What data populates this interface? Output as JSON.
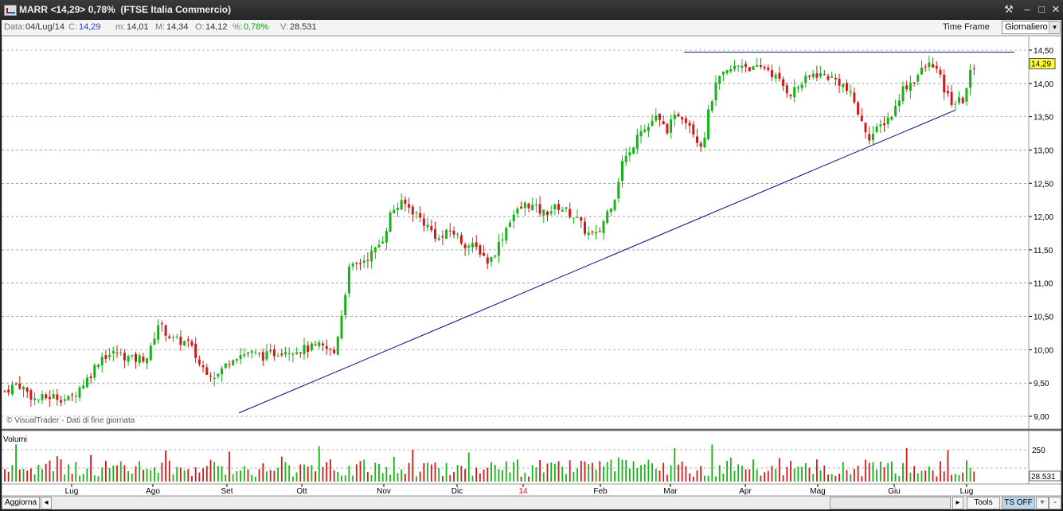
{
  "window": {
    "title": "MARR <14,29> 0,78%  (FTSE Italia Commercio)",
    "buttons": [
      "⚒",
      "–",
      "□",
      "✕"
    ]
  },
  "info": {
    "data_label": "Data:",
    "data_value": "04/Lug/14",
    "close_label": "C:",
    "close_value": "14,29",
    "min_label": "m:",
    "min_value": "14,01",
    "max_label": "M:",
    "max_value": "14,34",
    "open_label": "O:",
    "open_value": "14,12",
    "pct_label": "%:",
    "pct_value": "0,78%",
    "vol_label": "V:",
    "vol_value": "28.531",
    "timeframe_label": "Time Frame",
    "timeframe_value": "Giornaliero"
  },
  "chart_data": {
    "type": "candlestick",
    "security": "MARR",
    "watermark": "© VisualTrader - Dati di fine giornata",
    "y_ticks": [
      "14,50",
      "14,00",
      "13,50",
      "13,00",
      "12,50",
      "12,00",
      "11,50",
      "11,00",
      "10,50",
      "10,00",
      "9,50",
      "9,00"
    ],
    "ylim": [
      9.0,
      14.5
    ],
    "last_price_label": "14,29",
    "volume_label": "Volumi",
    "volume_tick": "250",
    "last_volume_label": "28.531",
    "x_labels": [
      "Lug",
      "Ago",
      "Set",
      "Ott",
      "Nov",
      "Dic",
      "14",
      "Feb",
      "Mar",
      "Apr",
      "Mag",
      "Giu",
      "Lug"
    ],
    "series": {
      "approximate_close_path": [
        [
          0,
          9.35
        ],
        [
          20,
          9.5
        ],
        [
          42,
          9.25
        ],
        [
          65,
          9.3
        ],
        [
          85,
          9.25
        ],
        [
          110,
          9.6
        ],
        [
          125,
          9.9
        ],
        [
          145,
          9.95
        ],
        [
          165,
          9.85
        ],
        [
          185,
          9.9
        ],
        [
          196,
          10.4
        ],
        [
          215,
          10.15
        ],
        [
          235,
          10.1
        ],
        [
          250,
          9.75
        ],
        [
          270,
          9.6
        ],
        [
          290,
          9.9
        ],
        [
          310,
          9.95
        ],
        [
          330,
          9.9
        ],
        [
          355,
          10.0
        ],
        [
          375,
          10.0
        ],
        [
          400,
          10.05
        ],
        [
          418,
          9.95
        ],
        [
          428,
          10.6
        ],
        [
          436,
          11.2
        ],
        [
          450,
          11.3
        ],
        [
          470,
          11.5
        ],
        [
          480,
          11.7
        ],
        [
          490,
          12.1
        ],
        [
          505,
          12.2
        ],
        [
          520,
          12.05
        ],
        [
          535,
          11.85
        ],
        [
          550,
          11.65
        ],
        [
          565,
          11.8
        ],
        [
          580,
          11.6
        ],
        [
          600,
          11.5
        ],
        [
          612,
          11.3
        ],
        [
          625,
          11.6
        ],
        [
          640,
          12.0
        ],
        [
          660,
          12.2
        ],
        [
          680,
          12.05
        ],
        [
          700,
          12.15
        ],
        [
          720,
          12.0
        ],
        [
          735,
          11.75
        ],
        [
          748,
          11.7
        ],
        [
          760,
          12.05
        ],
        [
          770,
          12.3
        ],
        [
          780,
          12.85
        ],
        [
          790,
          12.95
        ],
        [
          800,
          13.35
        ],
        [
          810,
          13.3
        ],
        [
          820,
          13.5
        ],
        [
          835,
          13.3
        ],
        [
          850,
          13.55
        ],
        [
          862,
          13.45
        ],
        [
          872,
          13.2
        ],
        [
          880,
          13.05
        ],
        [
          890,
          13.7
        ],
        [
          900,
          14.05
        ],
        [
          915,
          14.2
        ],
        [
          930,
          14.3
        ],
        [
          945,
          14.2
        ],
        [
          960,
          14.25
        ],
        [
          975,
          14.05
        ],
        [
          990,
          13.85
        ],
        [
          1005,
          14.0
        ],
        [
          1020,
          14.15
        ],
        [
          1040,
          14.1
        ],
        [
          1055,
          14.0
        ],
        [
          1070,
          13.75
        ],
        [
          1080,
          13.4
        ],
        [
          1090,
          13.2
        ],
        [
          1100,
          13.3
        ],
        [
          1110,
          13.45
        ],
        [
          1120,
          13.55
        ],
        [
          1130,
          13.9
        ],
        [
          1145,
          14.05
        ],
        [
          1160,
          14.25
        ],
        [
          1170,
          14.3
        ],
        [
          1178,
          14.1
        ],
        [
          1185,
          13.85
        ],
        [
          1195,
          13.7
        ],
        [
          1208,
          13.75
        ],
        [
          1215,
          14.1
        ],
        [
          1222,
          14.29
        ]
      ],
      "lines": [
        {
          "name": "support-trendline",
          "points": [
            [
              298,
              9.05
            ],
            [
              1198,
              13.6
            ]
          ],
          "color": "#1a1a8c"
        },
        {
          "name": "resistance-line",
          "points": [
            [
              857,
              14.47
            ],
            [
              1272,
              14.47
            ]
          ],
          "color": "#1a1a8c"
        }
      ]
    },
    "colors": {
      "up": "#16b316",
      "down": "#d01a1a",
      "grid": "#707070",
      "bg": "#ffffff",
      "last_price_bg": "#ffff33"
    }
  },
  "bottom": {
    "update_label": "Aggiorna",
    "tools_label": "Tools",
    "ts_label": "TS OFF",
    "plus_label": "+",
    "minus_label": "-"
  }
}
